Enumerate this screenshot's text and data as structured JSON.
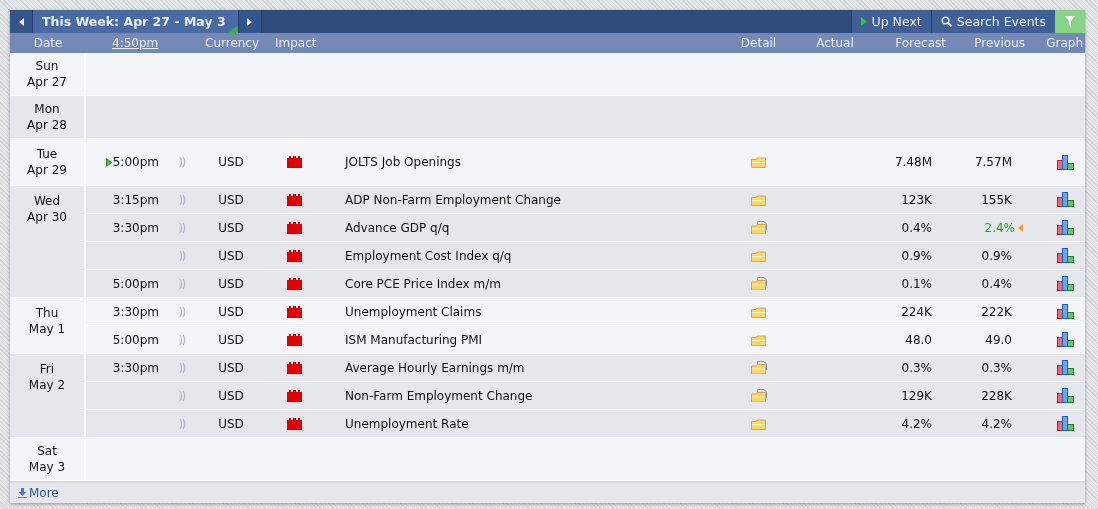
{
  "toolbar": {
    "title": "This Week: Apr 27 - May 3",
    "up_next": "Up Next",
    "search": "Search Events"
  },
  "columns": {
    "date": "Date",
    "current_time": "4:50pm",
    "currency": "Currency",
    "impact": "Impact",
    "detail": "Detail",
    "actual": "Actual",
    "forecast": "Forecast",
    "previous": "Previous",
    "graph": "Graph"
  },
  "days": [
    {
      "weekday": "Sun",
      "date": "Apr 27"
    },
    {
      "weekday": "Mon",
      "date": "Apr 28"
    },
    {
      "weekday": "Tue",
      "date": "Apr 29",
      "events": [
        {
          "time": "5:00pm",
          "next": true,
          "currency": "USD",
          "color": "#e00000",
          "title": "JOLTS Job Openings",
          "kind": "folder",
          "forecast": "7.48M",
          "previous": "7.57M",
          "previous_revised": false
        }
      ]
    },
    {
      "weekday": "Wed",
      "date": "Apr 30",
      "events": [
        {
          "time": "3:15pm",
          "next": false,
          "currency": "USD",
          "color": "#e00000",
          "title": "ADP Non-Farm Employment Change",
          "kind": "folder",
          "forecast": "123K",
          "previous": "155K",
          "previous_revised": false
        },
        {
          "time": "3:30pm",
          "next": false,
          "currency": "USD",
          "color": "#e00000",
          "title": "Advance GDP q/q",
          "kind": "folder-doc",
          "forecast": "0.4%",
          "previous": "2.4%",
          "previous_revised": true
        },
        {
          "next": false,
          "currency": "USD",
          "color": "#e00000",
          "title": "Employment Cost Index q/q",
          "kind": "folder",
          "forecast": "0.9%",
          "previous": "0.9%",
          "previous_revised": false
        },
        {
          "time": "5:00pm",
          "next": false,
          "currency": "USD",
          "color": "#e00000",
          "title": "Core PCE Price Index m/m",
          "kind": "folder-doc",
          "forecast": "0.1%",
          "previous": "0.4%",
          "previous_revised": false
        }
      ]
    },
    {
      "weekday": "Thu",
      "date": "May 1",
      "events": [
        {
          "time": "3:30pm",
          "next": false,
          "currency": "USD",
          "color": "#e00000",
          "title": "Unemployment Claims",
          "kind": "folder",
          "forecast": "224K",
          "previous": "222K",
          "previous_revised": false
        },
        {
          "time": "5:00pm",
          "next": false,
          "currency": "USD",
          "color": "#e00000",
          "title": "ISM Manufacturing PMI",
          "kind": "folder",
          "forecast": "48.0",
          "previous": "49.0",
          "previous_revised": false
        }
      ]
    },
    {
      "weekday": "Fri",
      "date": "May 2",
      "events": [
        {
          "time": "3:30pm",
          "next": false,
          "currency": "USD",
          "color": "#e00000",
          "title": "Average Hourly Earnings m/m",
          "kind": "folder-doc",
          "forecast": "0.3%",
          "previous": "0.3%",
          "previous_revised": false
        },
        {
          "next": false,
          "currency": "USD",
          "color": "#e00000",
          "title": "Non-Farm Employment Change",
          "kind": "folder-doc",
          "forecast": "129K",
          "previous": "228K",
          "previous_revised": false
        },
        {
          "next": false,
          "currency": "USD",
          "color": "#e00000",
          "title": "Unemployment Rate",
          "kind": "folder",
          "forecast": "4.2%",
          "previous": "4.2%",
          "previous_revised": false
        }
      ]
    },
    {
      "weekday": "Sat",
      "date": "May 3"
    }
  ],
  "footer": {
    "more": "More"
  }
}
